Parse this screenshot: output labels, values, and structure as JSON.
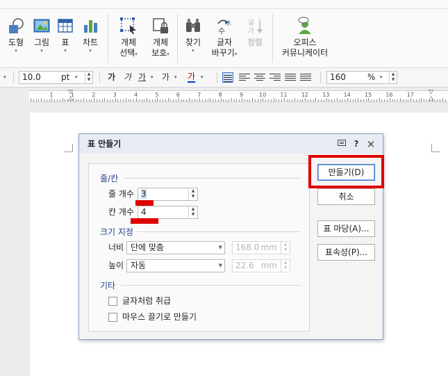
{
  "ribbon": {
    "items": [
      {
        "label": "도형",
        "has_arrow": true
      },
      {
        "label": "그림",
        "has_arrow": true
      },
      {
        "label": "표",
        "has_arrow": true
      },
      {
        "label": "차트",
        "has_arrow": true
      },
      {
        "label1": "개체",
        "label2": "선택"
      },
      {
        "label1": "개체",
        "label2": "보호"
      },
      {
        "label": "찾기",
        "has_arrow": true
      },
      {
        "label1": "글자",
        "label2": "바꾸기"
      },
      {
        "label": "정렬",
        "disabled": true
      },
      {
        "label1": "오피스",
        "label2": "커뮤니케이터"
      }
    ]
  },
  "format_bar": {
    "font_size": "10.0",
    "font_unit": "pt",
    "char_style_1": "가",
    "char_style_2": "가",
    "char_style_3": "가",
    "char_style_4": "가",
    "char_style_5": "가",
    "zoom": "160",
    "zoom_unit": "%"
  },
  "ruler": {
    "numbers": [
      "1",
      "1",
      "2",
      "3",
      "4",
      "5",
      "6",
      "7",
      "8",
      "9",
      "10",
      "11",
      "12",
      "13",
      "14",
      "15",
      "16",
      "17"
    ]
  },
  "dialog": {
    "title": "표 만들기",
    "section_rowcol": "줄/칸",
    "rows_label": "줄 개수",
    "rows_value": "3",
    "cols_label": "칸 개수",
    "cols_value": "4",
    "section_size": "크기 지정",
    "width_label": "너비",
    "width_mode": "단에 맞춤",
    "width_value": "168.0",
    "width_unit": "mm",
    "height_label": "높이",
    "height_mode": "자동",
    "height_value": "22.6",
    "height_unit": "mm",
    "section_etc": "기타",
    "check_treat_as_char": "글자처럼 취급",
    "check_draw_with_mouse": "마우스 끌기로 만들기",
    "btn_create": "만들기(D)",
    "btn_cancel": "취소",
    "btn_table_style": "표 마당(A)...",
    "btn_properties": "표속성(P)...",
    "help_glyph": "?",
    "close_glyph": "×"
  },
  "colors": {
    "highlight": "#e00000",
    "section_text": "#1f3d8a",
    "dialog_title_bg": "#e7ebf3"
  }
}
